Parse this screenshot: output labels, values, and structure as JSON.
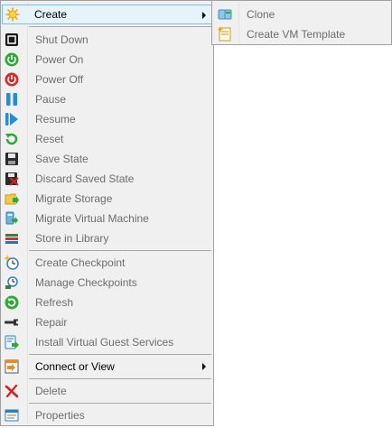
{
  "menu": {
    "items": [
      {
        "label": "Create",
        "icon": "create-sun-icon",
        "enabled": true,
        "submenu": true,
        "hover": true
      },
      {
        "label": "Shut Down",
        "icon": "shutdown-icon",
        "enabled": false
      },
      {
        "label": "Power On",
        "icon": "power-on-icon",
        "enabled": false
      },
      {
        "label": "Power Off",
        "icon": "power-off-icon",
        "enabled": false
      },
      {
        "label": "Pause",
        "icon": "pause-icon",
        "enabled": false
      },
      {
        "label": "Resume",
        "icon": "resume-icon",
        "enabled": false
      },
      {
        "label": "Reset",
        "icon": "reset-icon",
        "enabled": false
      },
      {
        "label": "Save State",
        "icon": "save-state-icon",
        "enabled": false
      },
      {
        "label": "Discard Saved State",
        "icon": "discard-saved-state-icon",
        "enabled": false
      },
      {
        "label": "Migrate Storage",
        "icon": "migrate-storage-icon",
        "enabled": false
      },
      {
        "label": "Migrate Virtual Machine",
        "icon": "migrate-vm-icon",
        "enabled": false
      },
      {
        "label": "Store in Library",
        "icon": "store-library-icon",
        "enabled": false
      },
      {
        "label": "Create Checkpoint",
        "icon": "create-checkpoint-icon",
        "enabled": false
      },
      {
        "label": "Manage Checkpoints",
        "icon": "manage-checkpoints-icon",
        "enabled": false
      },
      {
        "label": "Refresh",
        "icon": "refresh-icon",
        "enabled": false
      },
      {
        "label": "Repair",
        "icon": "repair-icon",
        "enabled": false
      },
      {
        "label": "Install Virtual Guest Services",
        "icon": "install-guest-services-icon",
        "enabled": false
      },
      {
        "label": "Connect or View",
        "icon": "connect-view-icon",
        "enabled": true,
        "submenu": true
      },
      {
        "label": "Delete",
        "icon": "delete-icon",
        "enabled": false
      },
      {
        "label": "Properties",
        "icon": "properties-icon",
        "enabled": false
      }
    ]
  },
  "submenu": {
    "items": [
      {
        "label": "Clone",
        "icon": "clone-icon",
        "enabled": false
      },
      {
        "label": "Create VM Template",
        "icon": "vm-template-icon",
        "enabled": false
      }
    ]
  },
  "colors": {
    "menu_bg": "#f0f0f0",
    "hover_bg": "#e5f3fb",
    "hover_border": "#7fbde8",
    "disabled_text": "#6d6d6d"
  }
}
